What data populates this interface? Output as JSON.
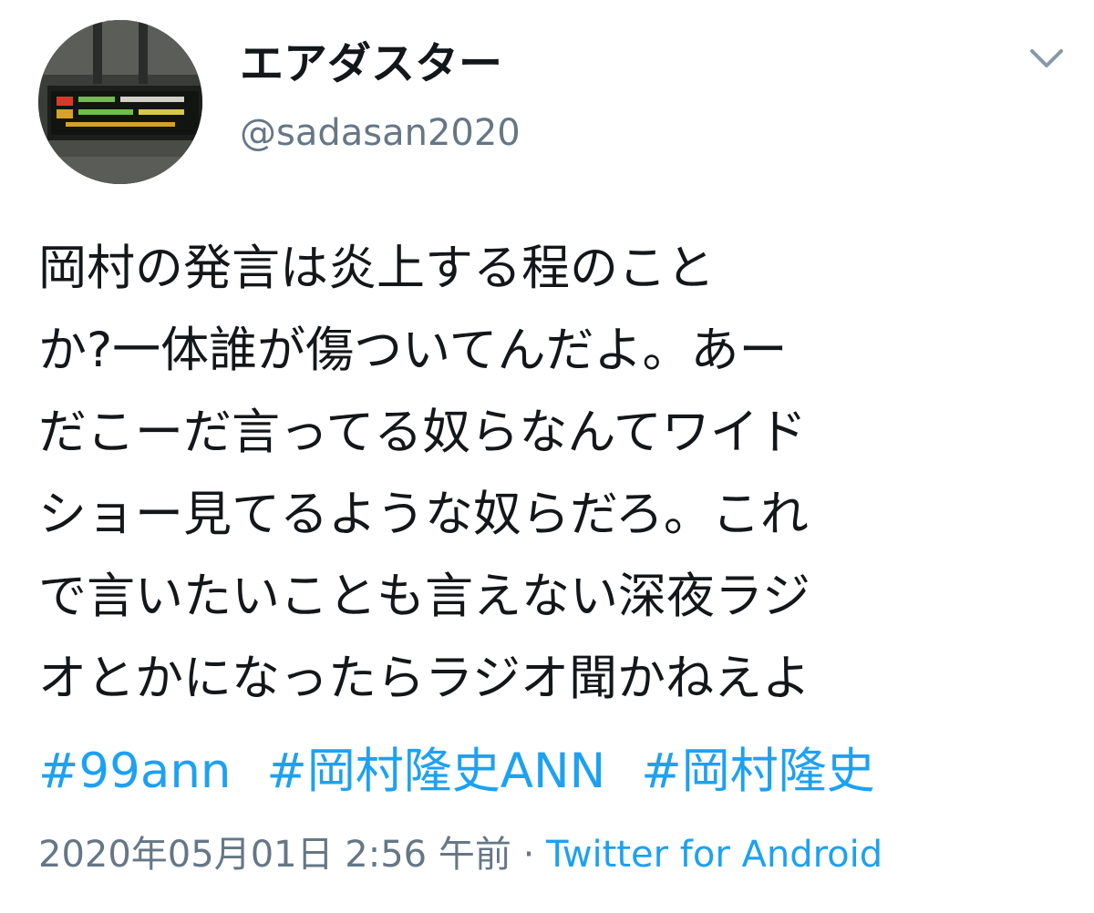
{
  "user": {
    "display_name": "エアダスター",
    "handle": "@sadasan2020",
    "avatar_icon": "station-departure-board-photo"
  },
  "header": {
    "more_icon": "chevron-down-icon"
  },
  "tweet": {
    "lines": [
      "岡村の発言は炎上する程のこと",
      "か?一体誰が傷ついてんだよ。あー",
      "だこーだ言ってる奴らなんてワイド",
      "ショー見てるような奴らだろ。これ",
      "で言いたいことも言えない深夜ラジ",
      "オとかになったらラジオ聞かねえよ"
    ],
    "hashtags": [
      "#99ann",
      "#岡村隆史ANN",
      "#岡村隆史"
    ]
  },
  "meta": {
    "timestamp": "2020年05月01日 2:56 午前",
    "separator": " · ",
    "source": "Twitter for Android"
  },
  "colors": {
    "link": "#1da1f2",
    "secondary_text": "#657786",
    "primary_text": "#14171a"
  }
}
